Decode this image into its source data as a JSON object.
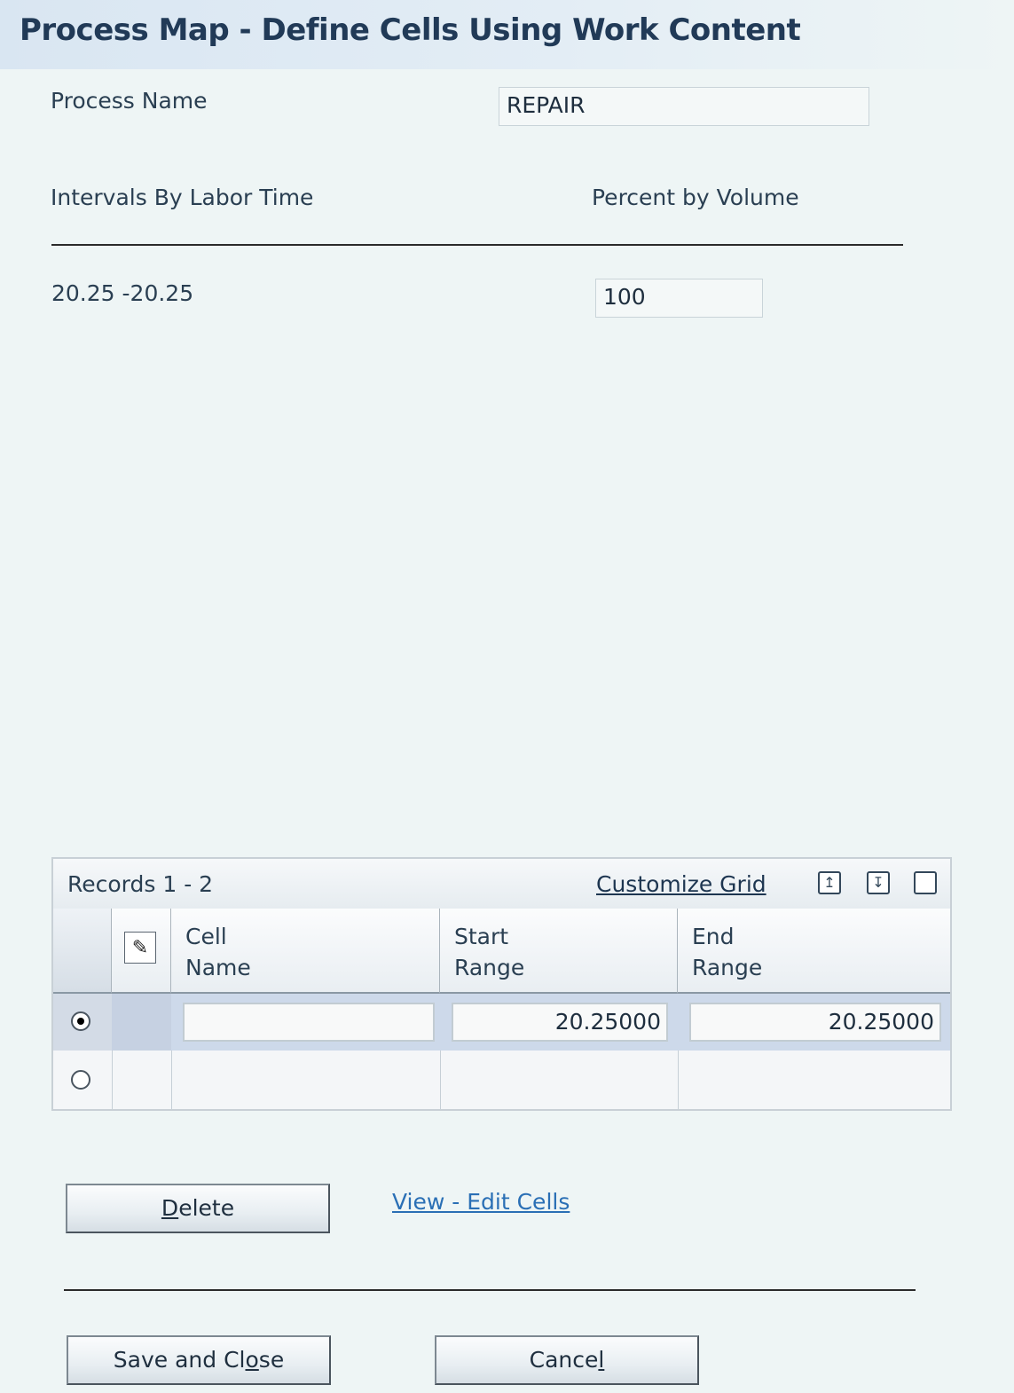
{
  "page": {
    "title": "Process Map - Define Cells Using Work Content"
  },
  "form": {
    "process_name_label": "Process Name",
    "process_name_value": "REPAIR",
    "intervals_label": "Intervals By Labor Time",
    "percent_label": "Percent by Volume",
    "interval_value": "20.25 -20.25",
    "percent_value": "100"
  },
  "grid": {
    "records": "Records 1 - 2",
    "customize": "Customize Grid",
    "icons": [
      "export-icon",
      "import-icon",
      "maximize-icon"
    ],
    "columns": [
      {
        "line1": "Cell",
        "line2": "Name"
      },
      {
        "line1": "Start",
        "line2": "Range"
      },
      {
        "line1": "End",
        "line2": "Range"
      }
    ],
    "rows": [
      {
        "selected": true,
        "cell_name": "",
        "start_range": "20.25000",
        "end_range": "20.25000"
      },
      {
        "selected": false,
        "cell_name": "",
        "start_range": "",
        "end_range": ""
      }
    ]
  },
  "actions": {
    "delete": {
      "mnemonic": "D",
      "rest": "elete"
    },
    "view_edit": "View - Edit Cells",
    "save": {
      "pre": "Save and Cl",
      "mnemonic": "o",
      "post": "se"
    },
    "cancel": {
      "pre": "Cance",
      "mnemonic": "l"
    }
  },
  "colors": {
    "title_text": "#213a57",
    "link": "#2a6fb5",
    "selected_row": "#cdd9ea"
  }
}
